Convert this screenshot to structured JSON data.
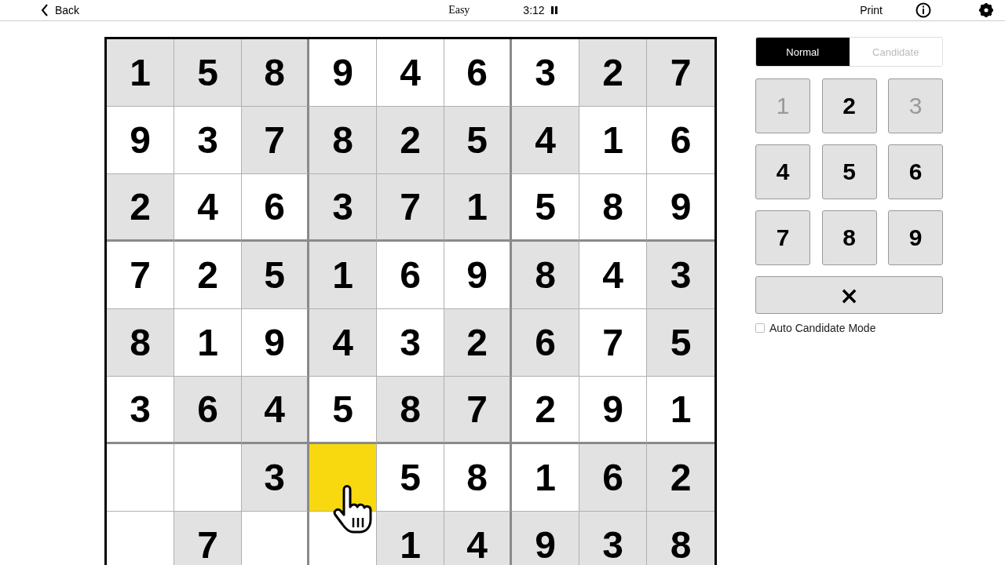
{
  "header": {
    "back": "Back",
    "difficulty": "Easy",
    "timer": "3:12",
    "print": "Print"
  },
  "board": {
    "rows": [
      [
        {
          "value": "1",
          "shaded": true
        },
        {
          "value": "5",
          "shaded": true
        },
        {
          "value": "8",
          "shaded": true
        },
        {
          "value": "9",
          "shaded": false
        },
        {
          "value": "4",
          "shaded": false
        },
        {
          "value": "6",
          "shaded": false
        },
        {
          "value": "3",
          "shaded": false
        },
        {
          "value": "2",
          "shaded": true
        },
        {
          "value": "7",
          "shaded": true
        }
      ],
      [
        {
          "value": "9",
          "shaded": false
        },
        {
          "value": "3",
          "shaded": false
        },
        {
          "value": "7",
          "shaded": true
        },
        {
          "value": "8",
          "shaded": true
        },
        {
          "value": "2",
          "shaded": true
        },
        {
          "value": "5",
          "shaded": true
        },
        {
          "value": "4",
          "shaded": true
        },
        {
          "value": "1",
          "shaded": false
        },
        {
          "value": "6",
          "shaded": false
        }
      ],
      [
        {
          "value": "2",
          "shaded": true
        },
        {
          "value": "4",
          "shaded": false
        },
        {
          "value": "6",
          "shaded": false
        },
        {
          "value": "3",
          "shaded": true
        },
        {
          "value": "7",
          "shaded": true
        },
        {
          "value": "1",
          "shaded": true
        },
        {
          "value": "5",
          "shaded": false
        },
        {
          "value": "8",
          "shaded": false
        },
        {
          "value": "9",
          "shaded": false
        }
      ],
      [
        {
          "value": "7",
          "shaded": false
        },
        {
          "value": "2",
          "shaded": false
        },
        {
          "value": "5",
          "shaded": true
        },
        {
          "value": "1",
          "shaded": true
        },
        {
          "value": "6",
          "shaded": false
        },
        {
          "value": "9",
          "shaded": false
        },
        {
          "value": "8",
          "shaded": true
        },
        {
          "value": "4",
          "shaded": false
        },
        {
          "value": "3",
          "shaded": true
        }
      ],
      [
        {
          "value": "8",
          "shaded": true
        },
        {
          "value": "1",
          "shaded": false
        },
        {
          "value": "9",
          "shaded": false
        },
        {
          "value": "4",
          "shaded": true
        },
        {
          "value": "3",
          "shaded": false
        },
        {
          "value": "2",
          "shaded": true
        },
        {
          "value": "6",
          "shaded": true
        },
        {
          "value": "7",
          "shaded": false
        },
        {
          "value": "5",
          "shaded": true
        }
      ],
      [
        {
          "value": "3",
          "shaded": false
        },
        {
          "value": "6",
          "shaded": true
        },
        {
          "value": "4",
          "shaded": true
        },
        {
          "value": "5",
          "shaded": false
        },
        {
          "value": "8",
          "shaded": true
        },
        {
          "value": "7",
          "shaded": true
        },
        {
          "value": "2",
          "shaded": false
        },
        {
          "value": "9",
          "shaded": false
        },
        {
          "value": "1",
          "shaded": false
        }
      ],
      [
        {
          "shaded": false
        },
        {
          "shaded": false
        },
        {
          "value": "3",
          "shaded": true
        },
        {
          "shaded": false,
          "selected": true
        },
        {
          "value": "5",
          "shaded": false
        },
        {
          "value": "8",
          "shaded": false
        },
        {
          "value": "1",
          "shaded": false
        },
        {
          "value": "6",
          "shaded": true
        },
        {
          "value": "2",
          "shaded": true
        }
      ],
      [
        {
          "shaded": false
        },
        {
          "value": "7",
          "shaded": true
        },
        {
          "shaded": false
        },
        {
          "shaded": false
        },
        {
          "value": "1",
          "shaded": true
        },
        {
          "value": "4",
          "shaded": true
        },
        {
          "value": "9",
          "shaded": true
        },
        {
          "value": "3",
          "shaded": true
        },
        {
          "value": "8",
          "shaded": true
        }
      ]
    ]
  },
  "modes": [
    {
      "label": "Normal",
      "selected": true
    },
    {
      "label": "Candidate",
      "selected": false
    }
  ],
  "keypad": [
    {
      "label": "1",
      "disabled": true
    },
    {
      "label": "2",
      "disabled": false
    },
    {
      "label": "3",
      "disabled": true
    },
    {
      "label": "4",
      "disabled": false
    },
    {
      "label": "5",
      "disabled": false
    },
    {
      "label": "6",
      "disabled": false
    },
    {
      "label": "7",
      "disabled": false
    },
    {
      "label": "8",
      "disabled": false
    },
    {
      "label": "9",
      "disabled": false
    }
  ],
  "erase": {
    "label": "×"
  },
  "auto_candidate": {
    "label": "Auto Candidate Mode",
    "checked": false
  }
}
